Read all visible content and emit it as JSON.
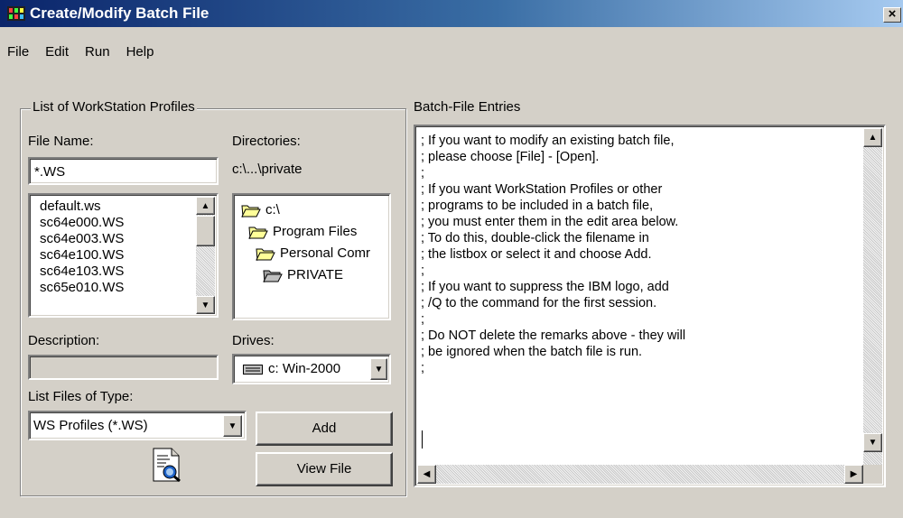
{
  "window": {
    "title": "Create/Modify Batch File",
    "close_label": "×"
  },
  "menu": [
    "File",
    "Edit",
    "Run",
    "Help"
  ],
  "profiles_group": {
    "legend": "List of WorkStation Profiles",
    "file_name_label": "File Name:",
    "file_name_value": "*.WS",
    "files": [
      "default.ws",
      "sc64e000.WS",
      "sc64e003.WS",
      "sc64e100.WS",
      "sc64e103.WS",
      "sc65e010.WS"
    ],
    "directories_label": "Directories:",
    "directories_path": "c:\\...\\private",
    "directories": [
      "c:\\",
      "Program Files",
      "Personal Comr",
      "PRIVATE"
    ],
    "description_label": "Description:",
    "description_value": "",
    "drives_label": "Drives:",
    "drive_value": "c: Win-2000",
    "list_type_label": "List Files of Type:",
    "list_type_value": "WS Profiles (*.WS)"
  },
  "buttons": {
    "add": "Add",
    "view_file": "View File"
  },
  "batch": {
    "label": "Batch-File Entries",
    "lines": [
      ";   If you want to modify an existing batch file,",
      ";   please choose [File] - [Open].",
      ";",
      ";   If you want WorkStation Profiles or other",
      ";   programs to be included in a batch file,",
      ";   you must enter them in the edit area below.",
      ";   To do this, double-click the filename in",
      ";   the listbox or select it and choose Add.",
      ";",
      ";   If you want to suppress the IBM logo, add",
      ";   /Q to the command for the first session.",
      ";",
      ";   Do NOT delete the remarks above - they will",
      ";   be ignored when the batch file is run.",
      ";"
    ]
  },
  "colors": {
    "title_start": "#0a246a",
    "title_end": "#a6caf0",
    "face": "#d4d0c8",
    "folder": "#ffff99"
  }
}
